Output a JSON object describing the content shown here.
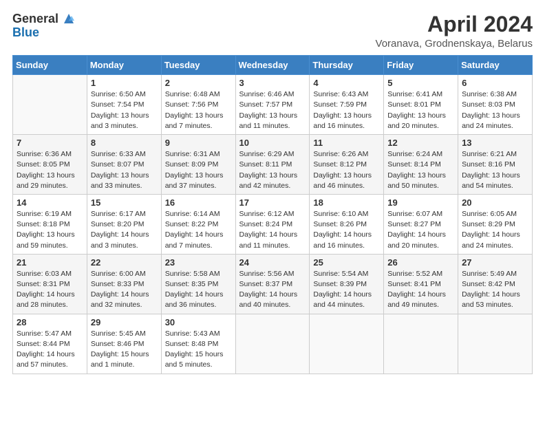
{
  "logo": {
    "line1": "General",
    "line2": "Blue"
  },
  "header": {
    "title": "April 2024",
    "subtitle": "Voranava, Grodnenskaya, Belarus"
  },
  "days_of_week": [
    "Sunday",
    "Monday",
    "Tuesday",
    "Wednesday",
    "Thursday",
    "Friday",
    "Saturday"
  ],
  "weeks": [
    [
      {
        "day": "",
        "sunrise": "",
        "sunset": "",
        "daylight": ""
      },
      {
        "day": "1",
        "sunrise": "Sunrise: 6:50 AM",
        "sunset": "Sunset: 7:54 PM",
        "daylight": "Daylight: 13 hours and 3 minutes."
      },
      {
        "day": "2",
        "sunrise": "Sunrise: 6:48 AM",
        "sunset": "Sunset: 7:56 PM",
        "daylight": "Daylight: 13 hours and 7 minutes."
      },
      {
        "day": "3",
        "sunrise": "Sunrise: 6:46 AM",
        "sunset": "Sunset: 7:57 PM",
        "daylight": "Daylight: 13 hours and 11 minutes."
      },
      {
        "day": "4",
        "sunrise": "Sunrise: 6:43 AM",
        "sunset": "Sunset: 7:59 PM",
        "daylight": "Daylight: 13 hours and 16 minutes."
      },
      {
        "day": "5",
        "sunrise": "Sunrise: 6:41 AM",
        "sunset": "Sunset: 8:01 PM",
        "daylight": "Daylight: 13 hours and 20 minutes."
      },
      {
        "day": "6",
        "sunrise": "Sunrise: 6:38 AM",
        "sunset": "Sunset: 8:03 PM",
        "daylight": "Daylight: 13 hours and 24 minutes."
      }
    ],
    [
      {
        "day": "7",
        "sunrise": "Sunrise: 6:36 AM",
        "sunset": "Sunset: 8:05 PM",
        "daylight": "Daylight: 13 hours and 29 minutes."
      },
      {
        "day": "8",
        "sunrise": "Sunrise: 6:33 AM",
        "sunset": "Sunset: 8:07 PM",
        "daylight": "Daylight: 13 hours and 33 minutes."
      },
      {
        "day": "9",
        "sunrise": "Sunrise: 6:31 AM",
        "sunset": "Sunset: 8:09 PM",
        "daylight": "Daylight: 13 hours and 37 minutes."
      },
      {
        "day": "10",
        "sunrise": "Sunrise: 6:29 AM",
        "sunset": "Sunset: 8:11 PM",
        "daylight": "Daylight: 13 hours and 42 minutes."
      },
      {
        "day": "11",
        "sunrise": "Sunrise: 6:26 AM",
        "sunset": "Sunset: 8:12 PM",
        "daylight": "Daylight: 13 hours and 46 minutes."
      },
      {
        "day": "12",
        "sunrise": "Sunrise: 6:24 AM",
        "sunset": "Sunset: 8:14 PM",
        "daylight": "Daylight: 13 hours and 50 minutes."
      },
      {
        "day": "13",
        "sunrise": "Sunrise: 6:21 AM",
        "sunset": "Sunset: 8:16 PM",
        "daylight": "Daylight: 13 hours and 54 minutes."
      }
    ],
    [
      {
        "day": "14",
        "sunrise": "Sunrise: 6:19 AM",
        "sunset": "Sunset: 8:18 PM",
        "daylight": "Daylight: 13 hours and 59 minutes."
      },
      {
        "day": "15",
        "sunrise": "Sunrise: 6:17 AM",
        "sunset": "Sunset: 8:20 PM",
        "daylight": "Daylight: 14 hours and 3 minutes."
      },
      {
        "day": "16",
        "sunrise": "Sunrise: 6:14 AM",
        "sunset": "Sunset: 8:22 PM",
        "daylight": "Daylight: 14 hours and 7 minutes."
      },
      {
        "day": "17",
        "sunrise": "Sunrise: 6:12 AM",
        "sunset": "Sunset: 8:24 PM",
        "daylight": "Daylight: 14 hours and 11 minutes."
      },
      {
        "day": "18",
        "sunrise": "Sunrise: 6:10 AM",
        "sunset": "Sunset: 8:26 PM",
        "daylight": "Daylight: 14 hours and 16 minutes."
      },
      {
        "day": "19",
        "sunrise": "Sunrise: 6:07 AM",
        "sunset": "Sunset: 8:27 PM",
        "daylight": "Daylight: 14 hours and 20 minutes."
      },
      {
        "day": "20",
        "sunrise": "Sunrise: 6:05 AM",
        "sunset": "Sunset: 8:29 PM",
        "daylight": "Daylight: 14 hours and 24 minutes."
      }
    ],
    [
      {
        "day": "21",
        "sunrise": "Sunrise: 6:03 AM",
        "sunset": "Sunset: 8:31 PM",
        "daylight": "Daylight: 14 hours and 28 minutes."
      },
      {
        "day": "22",
        "sunrise": "Sunrise: 6:00 AM",
        "sunset": "Sunset: 8:33 PM",
        "daylight": "Daylight: 14 hours and 32 minutes."
      },
      {
        "day": "23",
        "sunrise": "Sunrise: 5:58 AM",
        "sunset": "Sunset: 8:35 PM",
        "daylight": "Daylight: 14 hours and 36 minutes."
      },
      {
        "day": "24",
        "sunrise": "Sunrise: 5:56 AM",
        "sunset": "Sunset: 8:37 PM",
        "daylight": "Daylight: 14 hours and 40 minutes."
      },
      {
        "day": "25",
        "sunrise": "Sunrise: 5:54 AM",
        "sunset": "Sunset: 8:39 PM",
        "daylight": "Daylight: 14 hours and 44 minutes."
      },
      {
        "day": "26",
        "sunrise": "Sunrise: 5:52 AM",
        "sunset": "Sunset: 8:41 PM",
        "daylight": "Daylight: 14 hours and 49 minutes."
      },
      {
        "day": "27",
        "sunrise": "Sunrise: 5:49 AM",
        "sunset": "Sunset: 8:42 PM",
        "daylight": "Daylight: 14 hours and 53 minutes."
      }
    ],
    [
      {
        "day": "28",
        "sunrise": "Sunrise: 5:47 AM",
        "sunset": "Sunset: 8:44 PM",
        "daylight": "Daylight: 14 hours and 57 minutes."
      },
      {
        "day": "29",
        "sunrise": "Sunrise: 5:45 AM",
        "sunset": "Sunset: 8:46 PM",
        "daylight": "Daylight: 15 hours and 1 minute."
      },
      {
        "day": "30",
        "sunrise": "Sunrise: 5:43 AM",
        "sunset": "Sunset: 8:48 PM",
        "daylight": "Daylight: 15 hours and 5 minutes."
      },
      {
        "day": "",
        "sunrise": "",
        "sunset": "",
        "daylight": ""
      },
      {
        "day": "",
        "sunrise": "",
        "sunset": "",
        "daylight": ""
      },
      {
        "day": "",
        "sunrise": "",
        "sunset": "",
        "daylight": ""
      },
      {
        "day": "",
        "sunrise": "",
        "sunset": "",
        "daylight": ""
      }
    ]
  ]
}
